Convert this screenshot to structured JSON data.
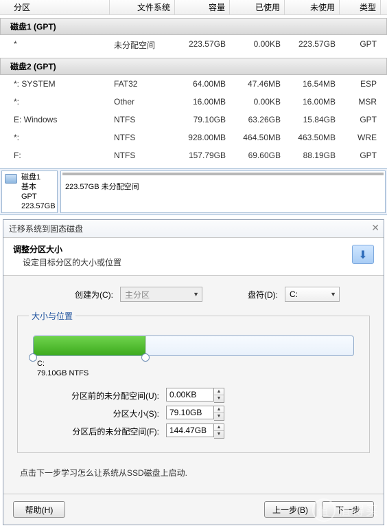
{
  "table": {
    "headers": {
      "partition": "分区",
      "filesystem": "文件系统",
      "capacity": "容量",
      "used": "已使用",
      "unused": "未使用",
      "type": "类型"
    },
    "groups": [
      {
        "title": "磁盘1  (GPT)",
        "rows": [
          {
            "part": "*",
            "fs": "未分配空间",
            "cap": "223.57GB",
            "used": "0.00KB",
            "free": "223.57GB",
            "type": "GPT"
          }
        ]
      },
      {
        "title": "磁盘2  (GPT)",
        "rows": [
          {
            "part": "*: SYSTEM",
            "fs": "FAT32",
            "cap": "64.00MB",
            "used": "47.46MB",
            "free": "16.54MB",
            "type": "ESP"
          },
          {
            "part": "*:",
            "fs": "Other",
            "cap": "16.00MB",
            "used": "0.00KB",
            "free": "16.00MB",
            "type": "MSR"
          },
          {
            "part": "E: Windows",
            "fs": "NTFS",
            "cap": "79.10GB",
            "used": "63.26GB",
            "free": "15.84GB",
            "type": "GPT"
          },
          {
            "part": "*:",
            "fs": "NTFS",
            "cap": "928.00MB",
            "used": "464.50MB",
            "free": "463.50MB",
            "type": "WRE"
          },
          {
            "part": "F:",
            "fs": "NTFS",
            "cap": "157.79GB",
            "used": "69.60GB",
            "free": "88.19GB",
            "type": "GPT"
          }
        ]
      }
    ]
  },
  "diskmap": {
    "name": "磁盘1",
    "info_line2": "基本 GPT",
    "info_line3": "223.57GB",
    "space_label": "223.57GB 未分配空间"
  },
  "dialog": {
    "title": "迁移系统到固态磁盘",
    "header_title": "调整分区大小",
    "header_sub": "设定目标分区的大小或位置",
    "create_as_label": "创建为(C):",
    "create_as_value": "主分区",
    "drive_label": "盘符(D):",
    "drive_value": "C:",
    "groupbox": "大小与位置",
    "slider": {
      "line1": "C:",
      "line2": "79.10GB NTFS",
      "fill_percent": 35
    },
    "fields": {
      "before_label": "分区前的未分配空间(U):",
      "before_value": "0.00KB",
      "size_label": "分区大小(S):",
      "size_value": "79.10GB",
      "after_label": "分区后的未分配空间(F):",
      "after_value": "144.47GB"
    },
    "hint": "点击下一步学习怎么让系统从SSD磁盘上启动.",
    "buttons": {
      "help": "帮助(H)",
      "back": "上一步(B)",
      "next": "下一步"
    }
  },
  "watermark": "值得买"
}
